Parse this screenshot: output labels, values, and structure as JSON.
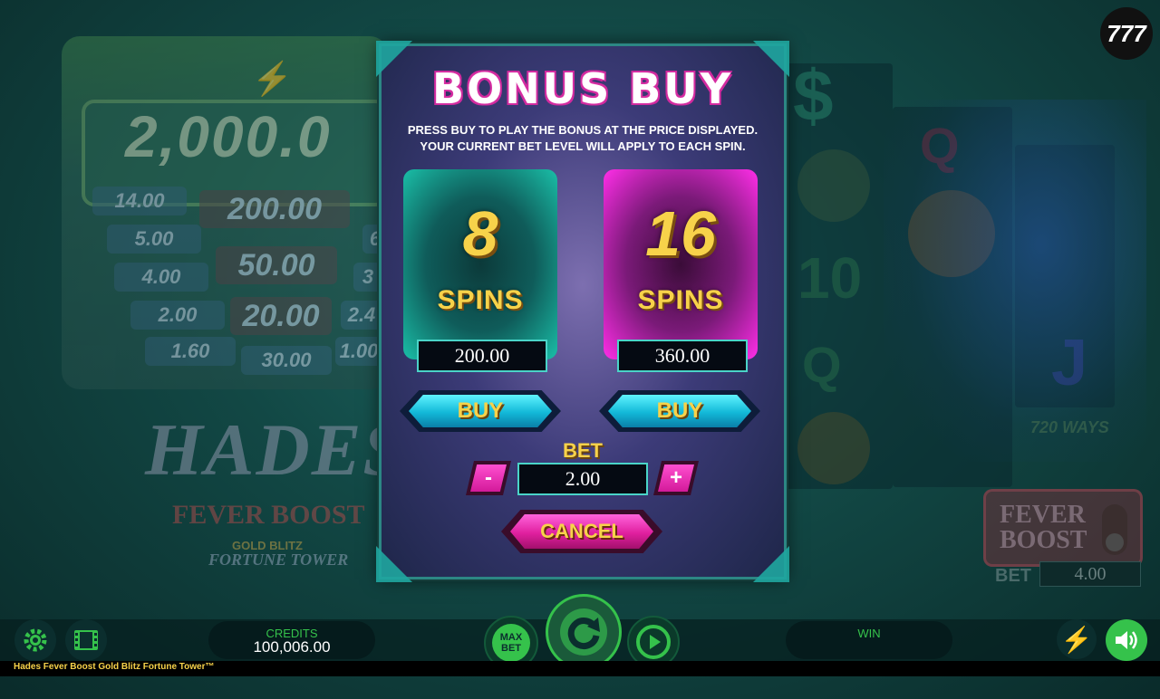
{
  "badge": "777",
  "jackpot": {
    "top": "2,000.0",
    "rows": [
      {
        "left": "14.00",
        "mid": "200.00"
      },
      {
        "left": "5.00",
        "mid": ""
      },
      {
        "left": "4.00",
        "mid": "50.00",
        "right": "3"
      },
      {
        "left": "2.00",
        "mid": "20.00",
        "right": "2.4"
      },
      {
        "left": "1.60",
        "mid": "30.00",
        "right": "1.00"
      }
    ],
    "row2_right": "6"
  },
  "logo": {
    "line1": "HADES",
    "line2": "FEVER BOOST",
    "line3": "GOLD BLITZ",
    "line4": "FORTUNE TOWER"
  },
  "reels": {
    "ways": "720 WAYS"
  },
  "fever_boost": {
    "label_line1": "FEVER",
    "label_line2": "BOOST",
    "bet_label": "BET",
    "bet_value": "4.00"
  },
  "modal": {
    "title": "BONUS BUY",
    "instruction_line1": "PRESS BUY TO PLAY THE BONUS AT THE PRICE DISPLAYED.",
    "instruction_line2": "YOUR CURRENT BET LEVEL WILL APPLY TO EACH SPIN.",
    "options": [
      {
        "spins": "8",
        "spins_label": "SPINS",
        "price": "200.00",
        "buy_label": "BUY"
      },
      {
        "spins": "16",
        "spins_label": "SPINS",
        "price": "360.00",
        "buy_label": "BUY"
      }
    ],
    "bet_title": "BET",
    "bet_value": "2.00",
    "minus_label": "-",
    "plus_label": "+",
    "cancel_label": "CANCEL"
  },
  "bottom": {
    "credits_label": "CREDITS",
    "credits_value": "100,006.00",
    "max_bet_label": "MAX BET",
    "win_label": "WIN",
    "game_title": "Hades Fever Boost Gold Blitz Fortune Tower™"
  },
  "colors": {
    "accent_gold": "#f7d24a",
    "teal": "#1abfa8",
    "pink": "#ff2ee8",
    "green_label": "#35c24b"
  }
}
